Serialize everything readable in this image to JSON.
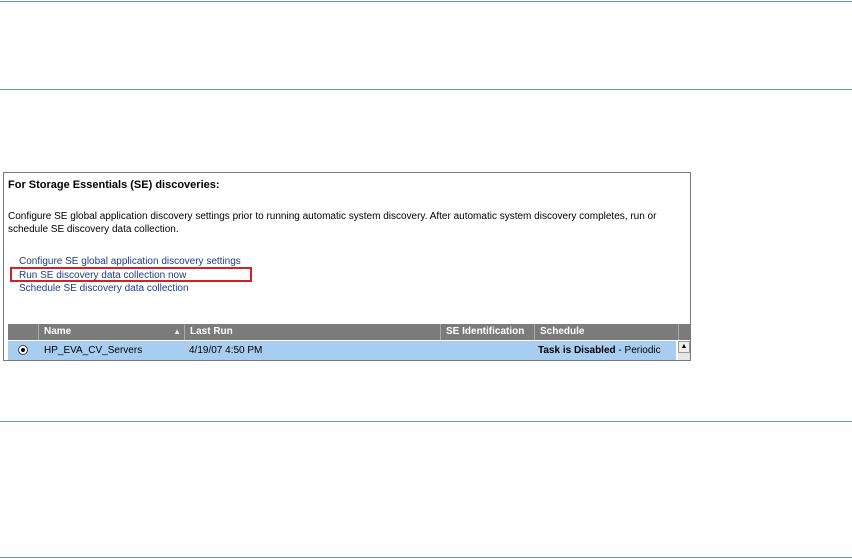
{
  "panel": {
    "heading": "For Storage Essentials (SE) discoveries:",
    "description": "Configure SE global application discovery settings prior to running automatic system discovery. After automatic system discovery completes, run or schedule SE discovery data collection.",
    "links": [
      "Configure SE global application discovery settings",
      "Run SE discovery data collection now",
      "Schedule SE discovery data collection"
    ],
    "highlight_color": "#d42020"
  },
  "grid": {
    "columns": [
      "",
      "Name",
      "Last Run",
      "SE Identification",
      "Schedule"
    ],
    "sort_icon": "arrow-up-icon",
    "rows": [
      {
        "selected": true,
        "name": "HP_EVA_CV_Servers",
        "last_run": "4/19/07 4:50 PM",
        "se_identification": "",
        "schedule_status": "Task is Disabled",
        "schedule_type": " - Periodic"
      }
    ]
  },
  "colors": {
    "rule": "#5b9ad6",
    "header_bg": "#7b7b7b",
    "selected_row": "#a9cdf1",
    "link": "#1c3c8c"
  }
}
